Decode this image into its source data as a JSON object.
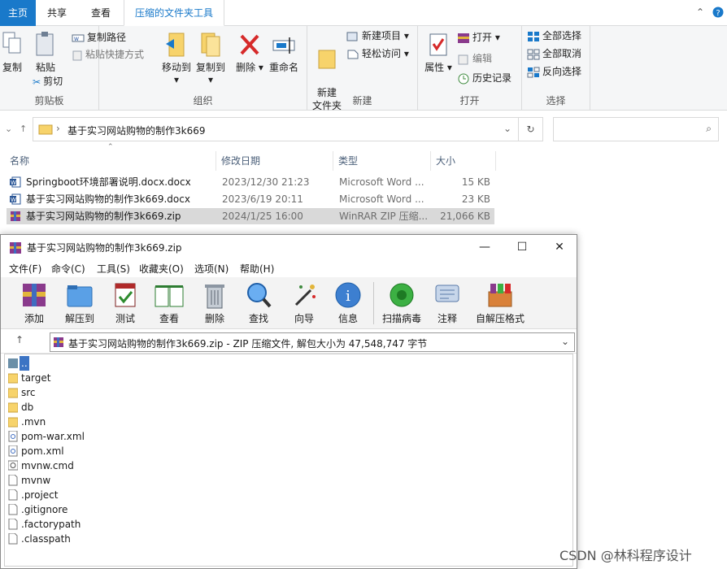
{
  "explorer": {
    "tabs": {
      "home": "主页",
      "share": "共享",
      "view": "查看",
      "tools": "压缩的文件夹工具"
    },
    "ribbon": {
      "clipboard": {
        "label": "剪贴板",
        "copy": "复制",
        "paste": "粘贴",
        "copy_path": "复制路径",
        "paste_shortcut": "粘贴快捷方式",
        "cut": "剪切"
      },
      "organize": {
        "label": "组织",
        "move_to": "移动到",
        "copy_to": "复制到",
        "delete": "删除",
        "rename": "重命名"
      },
      "new": {
        "label": "新建",
        "new_folder": "新建\n文件夹",
        "new_item": "新建项目",
        "easy_access": "轻松访问"
      },
      "open": {
        "label": "打开",
        "properties": "属性",
        "open": "打开",
        "edit": "编辑",
        "history": "历史记录"
      },
      "select": {
        "label": "选择",
        "select_all": "全部选择",
        "select_none": "全部取消",
        "invert": "反向选择"
      }
    },
    "address": {
      "path": "基于实习网站购物的制作3k669",
      "search_placeholder": ""
    },
    "columns": {
      "name": "名称",
      "date": "修改日期",
      "type": "类型",
      "size": "大小"
    },
    "files": [
      {
        "name": "Springboot环境部署说明.docx.docx",
        "date": "2023/12/30 21:23",
        "type": "Microsoft Word ...",
        "size": "15 KB",
        "icon": "word-icon"
      },
      {
        "name": "基于实习网站购物的制作3k669.docx",
        "date": "2023/6/19 20:11",
        "type": "Microsoft Word ...",
        "size": "23 KB",
        "icon": "word-icon"
      },
      {
        "name": "基于实习网站购物的制作3k669.zip",
        "date": "2024/1/25 16:00",
        "type": "WinRAR ZIP 压缩...",
        "size": "21,066 KB",
        "icon": "winrar-icon",
        "selected": true
      }
    ]
  },
  "winrar": {
    "title": "基于实习网站购物的制作3k669.zip",
    "menu": [
      "文件(F)",
      "命令(C)",
      "工具(S)",
      "收藏夹(O)",
      "选项(N)",
      "帮助(H)"
    ],
    "toolbar": [
      "添加",
      "解压到",
      "测试",
      "查看",
      "删除",
      "查找",
      "向导",
      "信息",
      "扫描病毒",
      "注释",
      "自解压格式"
    ],
    "path_text": "基于实习网站购物的制作3k669.zip - ZIP 压缩文件, 解包大小为 47,548,747 字节",
    "items": [
      {
        "name": "..",
        "kind": "up"
      },
      {
        "name": "target",
        "kind": "folder"
      },
      {
        "name": "src",
        "kind": "folder"
      },
      {
        "name": "db",
        "kind": "folder"
      },
      {
        "name": ".mvn",
        "kind": "folder"
      },
      {
        "name": "pom-war.xml",
        "kind": "xml"
      },
      {
        "name": "pom.xml",
        "kind": "xml"
      },
      {
        "name": "mvnw.cmd",
        "kind": "cmd"
      },
      {
        "name": "mvnw",
        "kind": "file"
      },
      {
        "name": ".project",
        "kind": "file"
      },
      {
        "name": ".gitignore",
        "kind": "file"
      },
      {
        "name": ".factorypath",
        "kind": "file"
      },
      {
        "name": ".classpath",
        "kind": "file"
      }
    ]
  },
  "watermark": "CSDN @林科程序设计"
}
